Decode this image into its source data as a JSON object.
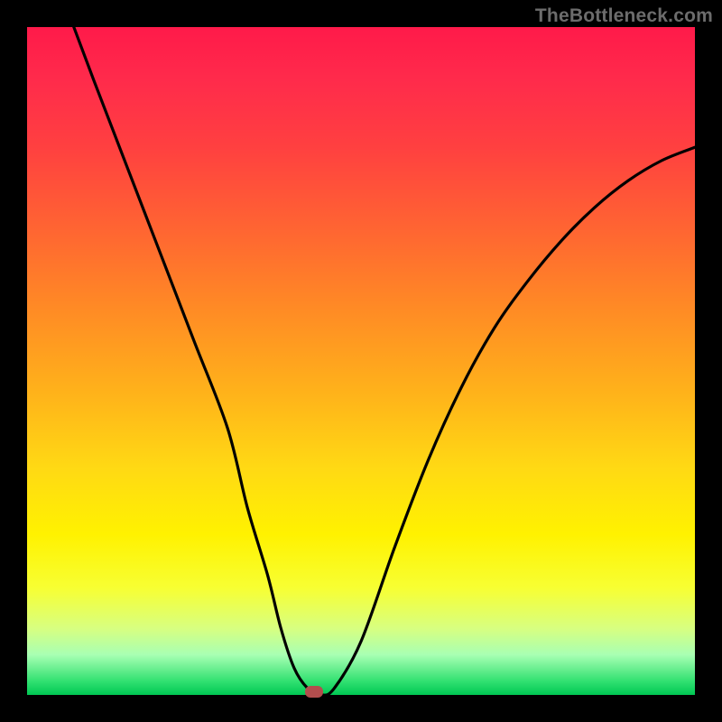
{
  "watermark": "TheBottleneck.com",
  "chart_data": {
    "type": "line",
    "title": "",
    "xlabel": "",
    "ylabel": "",
    "xlim": [
      0,
      100
    ],
    "ylim": [
      0,
      100
    ],
    "series": [
      {
        "name": "curve",
        "x": [
          7,
          10,
          15,
          20,
          25,
          30,
          33,
          36,
          38,
          40,
          42,
          44,
          46,
          50,
          55,
          60,
          65,
          70,
          75,
          80,
          85,
          90,
          95,
          100
        ],
        "y": [
          100,
          92,
          79,
          66,
          53,
          40,
          28,
          18,
          10,
          4,
          1,
          0,
          1,
          8,
          22,
          35,
          46,
          55,
          62,
          68,
          73,
          77,
          80,
          82
        ]
      }
    ],
    "marker": {
      "x": 43,
      "y": 0.5
    },
    "colors": {
      "curve": "#000000",
      "marker": "#b24d4d",
      "background_top": "#ff1a4a",
      "background_bottom": "#00c853",
      "frame": "#000000"
    }
  }
}
